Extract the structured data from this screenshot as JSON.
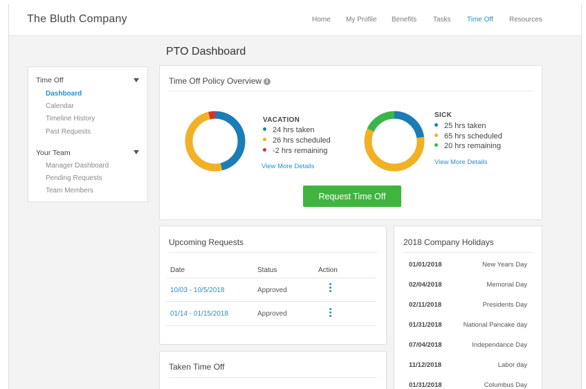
{
  "app": {
    "brand": "The Bluth Company"
  },
  "nav": {
    "items": [
      "Home",
      "My Profile",
      "Benefits",
      "Tasks",
      "Time Off",
      "Resources"
    ],
    "active": "Time Off"
  },
  "page": {
    "title": "PTO Dashboard"
  },
  "sidebar": {
    "groups": [
      {
        "label": "Time Off",
        "items": [
          "Dashboard",
          "Calendar",
          "Timeline History",
          "Past Requests"
        ],
        "active": "Dashboard"
      },
      {
        "label": "Your Team",
        "items": [
          "Manager Dashboard",
          "Pending Requests",
          "Team Members"
        ]
      }
    ]
  },
  "policy": {
    "title": "Time Off Policy Overview",
    "info_icon": "i",
    "vacation": {
      "title": "VACATION",
      "rows": [
        "24 hrs taken",
        "26 hrs scheduled",
        "-2 hrs remaining"
      ],
      "colors": [
        "#1a7db5",
        "#f2b125",
        "#d9302b"
      ],
      "chart_share": [
        0.48,
        0.52,
        0.04
      ],
      "link": "View More Details"
    },
    "sick": {
      "title": "SICK",
      "rows": [
        "25 hrs taken",
        "65 hrs scheduled",
        "20 hrs remaining"
      ],
      "colors": [
        "#1a7db5",
        "#f2b125",
        "#39b54a"
      ],
      "chart_share": [
        0.227,
        0.591,
        0.182
      ],
      "link": "View More Details"
    },
    "button": "Request Time Off"
  },
  "upcoming": {
    "title": "Upcoming Requests",
    "headers": [
      "Date",
      "Status",
      "Action"
    ],
    "rows": [
      {
        "date": "10/03 - 10/5/2018",
        "status": "Approved"
      },
      {
        "date": "01/14 - 01/15/2018",
        "status": "Approved"
      }
    ]
  },
  "taken": {
    "title": "Taken Time Off"
  },
  "holidays": {
    "title": "2018 Company Holidays",
    "rows": [
      {
        "date": "01/01/2018",
        "name": "New Years Day"
      },
      {
        "date": "02/04/2018",
        "name": "Memorial Day"
      },
      {
        "date": "02/11/2018",
        "name": "Presidents Day"
      },
      {
        "date": "01/31/2018",
        "name": "National Pancake day"
      },
      {
        "date": "07/04/2018",
        "name": "Independance Day"
      },
      {
        "date": "11/12/2018",
        "name": "Labor day"
      },
      {
        "date": "01/31/2018",
        "name": "Columbus Day"
      }
    ]
  }
}
